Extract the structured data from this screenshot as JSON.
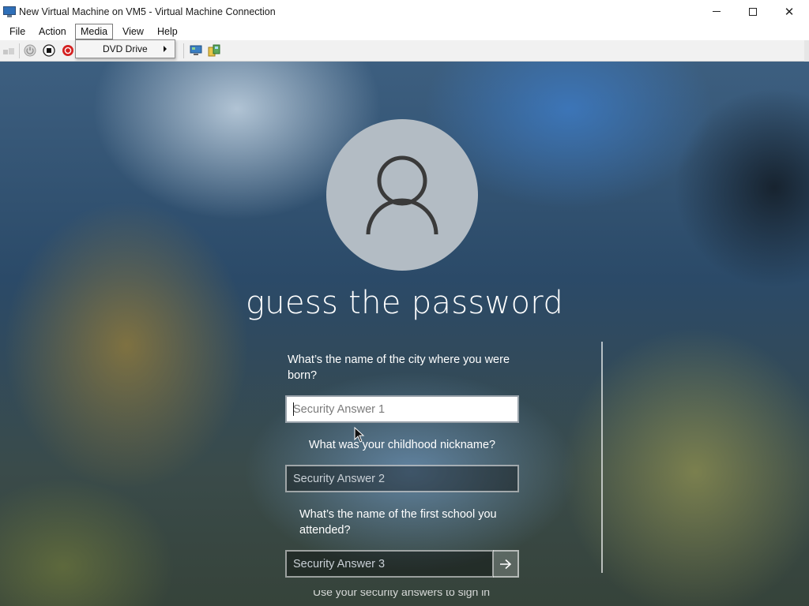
{
  "window": {
    "title": "New Virtual Machine on VM5 - Virtual Machine Connection",
    "controls": {
      "minimize": "minimize",
      "maximize": "maximize",
      "close": "✕"
    }
  },
  "menubar": {
    "items": [
      "File",
      "Action",
      "Media",
      "View",
      "Help"
    ],
    "active": "Media"
  },
  "media_menu": {
    "items": [
      {
        "label": "DVD Drive",
        "has_submenu": true
      }
    ]
  },
  "toolbar": {
    "icons": [
      "ctrl-alt-del-icon",
      "start-icon",
      "turn-off-icon",
      "shutdown-icon",
      "enhanced-session-icon",
      "share-icon"
    ]
  },
  "login": {
    "username": "guess the password",
    "questions": [
      {
        "text": "What’s the name of the city where you were born?",
        "placeholder": "Security Answer 1",
        "focused": true
      },
      {
        "text": "What was your childhood nickname?",
        "placeholder": "Security Answer 2",
        "focused": false
      },
      {
        "text": "What’s the name of the first school you attended?",
        "placeholder": "Security Answer 3",
        "focused": false
      }
    ],
    "cut_off_text": "Use your security answers to sign in",
    "submit_icon": "arrow-right-icon"
  },
  "colors": {
    "avatar_bg": "#b3bcc4",
    "text": "#ffffff",
    "menu_active_border": "#7a7a7a"
  }
}
